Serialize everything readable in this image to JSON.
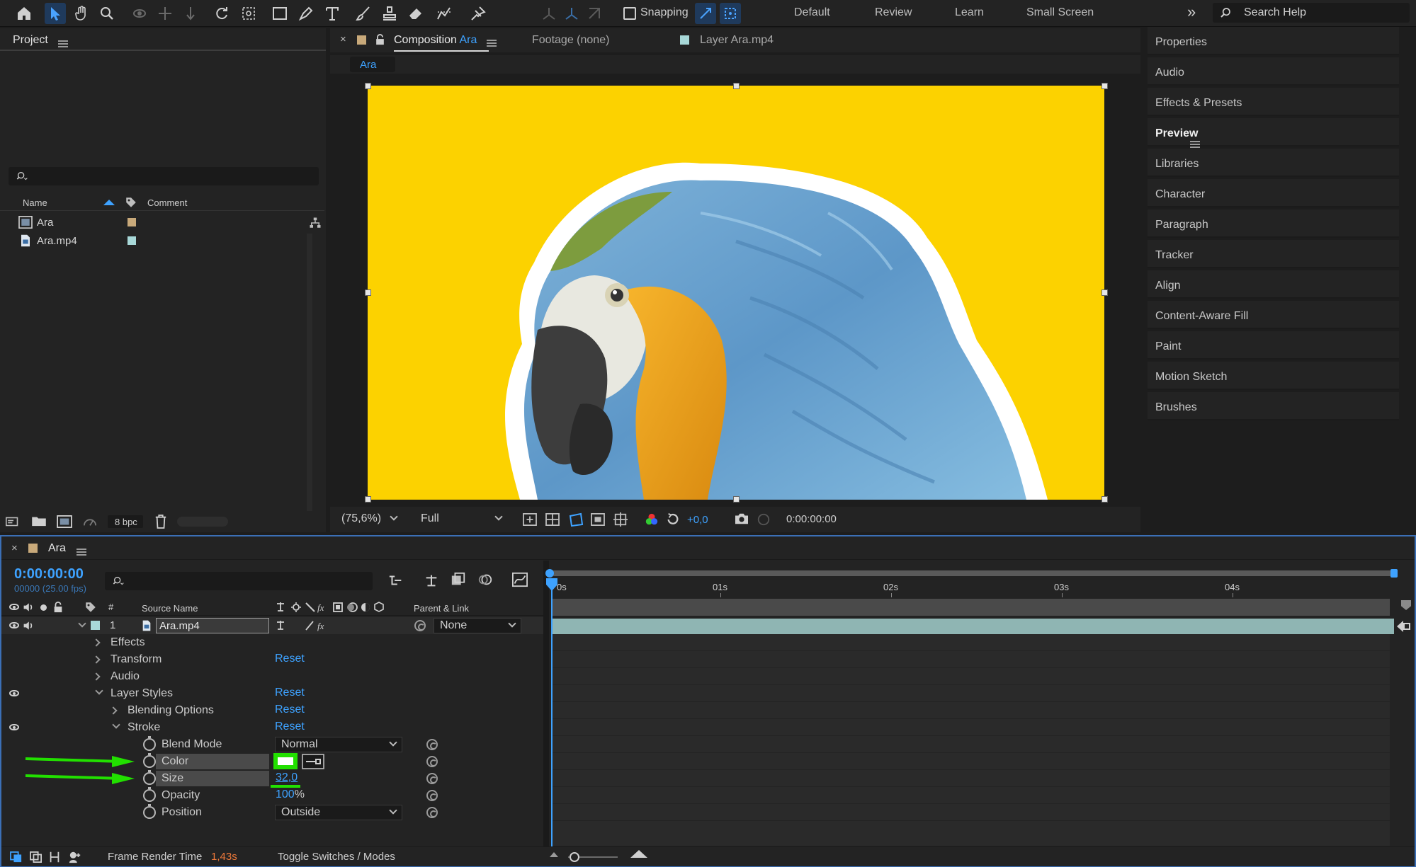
{
  "toolbar": {
    "snapping_label": "Snapping",
    "workspaces": [
      "Default",
      "Review",
      "Learn",
      "Small Screen"
    ],
    "search_placeholder": "Search Help",
    "overflow": "»"
  },
  "project": {
    "title": "Project",
    "columns": {
      "name": "Name",
      "comment": "Comment"
    },
    "items": [
      {
        "name": "Ara",
        "type": "composition",
        "label_color": "#c8a97a"
      },
      {
        "name": "Ara.mp4",
        "type": "footage",
        "label_color": "#a8d8d8"
      }
    ],
    "bit_depth": "8 bpc"
  },
  "viewer": {
    "tabs": [
      {
        "prefix": "Composition",
        "name": "Ara"
      },
      {
        "prefix": "Footage",
        "name": "(none)"
      },
      {
        "prefix": "Layer",
        "name": "Ara.mp4"
      }
    ],
    "breadcrumb": "Ara",
    "background_color": "#fcd200",
    "zoom": "(75,6%)",
    "resolution": "Full",
    "exposure": "+0,0",
    "timecode": "0:00:00:00"
  },
  "right_panel": {
    "items": [
      "Properties",
      "Audio",
      "Effects & Presets",
      "Preview",
      "Libraries",
      "Character",
      "Paragraph",
      "Tracker",
      "Align",
      "Content-Aware Fill",
      "Paint",
      "Motion Sketch",
      "Brushes"
    ],
    "active": "Preview"
  },
  "timeline": {
    "comp_name": "Ara",
    "current_time": "0:00:00:00",
    "frame_info": "00000 (25.00 fps)",
    "columns": {
      "number": "#",
      "source_name": "Source Name",
      "parent_link": "Parent & Link"
    },
    "layer": {
      "number": "1",
      "name": "Ara.mp4",
      "parent": "None"
    },
    "ruler": [
      "0s",
      "01s",
      "02s",
      "03s",
      "04s"
    ],
    "properties": {
      "effects": "Effects",
      "transform": "Transform",
      "audio": "Audio",
      "layer_styles": "Layer Styles",
      "blending_options": "Blending Options",
      "stroke": "Stroke",
      "blend_mode": "Blend Mode",
      "blend_mode_value": "Normal",
      "color": "Color",
      "color_value": "#ffffff",
      "size": "Size",
      "size_value": "32,0",
      "opacity": "Opacity",
      "opacity_value": "100",
      "opacity_unit": "%",
      "position": "Position",
      "position_value": "Outside",
      "reset": "Reset"
    },
    "footer": {
      "frame_render_label": "Frame Render Time",
      "frame_render_value": "1,43s",
      "toggle_label": "Toggle Switches / Modes"
    }
  },
  "annotation_color": "#22e000",
  "accent_color": "#3ea2ff"
}
